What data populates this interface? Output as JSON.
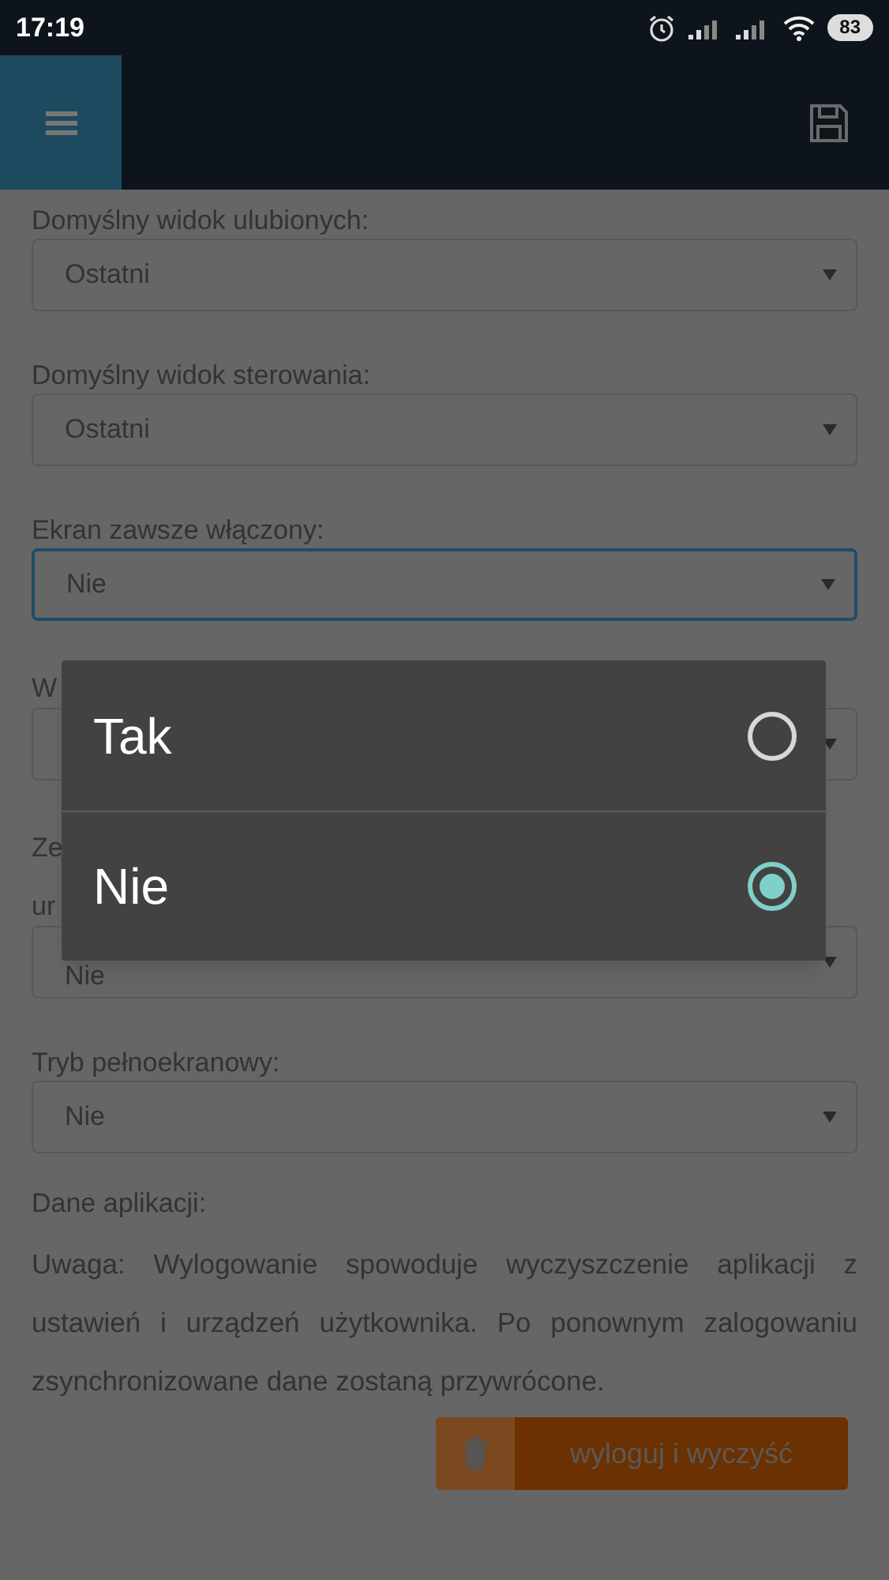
{
  "status_bar": {
    "time": "17:19",
    "battery": "83"
  },
  "form": [
    {
      "label": "Domyślny widok ulubionych:",
      "value": "Ostatni",
      "focused": false
    },
    {
      "label": "Domyślny widok sterowania:",
      "value": "Ostatni",
      "focused": false
    },
    {
      "label": "Ekran zawsze włączony:",
      "value": "Nie",
      "focused": true
    },
    {
      "label_lines": [
        "W"
      ],
      "focused": false
    },
    {
      "label_lines": [
        "Ze",
        "ur"
      ],
      "value": "Nie",
      "focused": false
    },
    {
      "label": "Tryb pełnoekranowy:",
      "value": "Nie",
      "focused": false
    }
  ],
  "app_data": {
    "label": "Dane aplikacji:",
    "note": "Uwaga: Wylogowanie spowoduje wyczyszczenie aplikacji z ustawień i urządzeń użytkownika. Po ponownym zalogowaniu zsynchronizowane dane zostaną przywrócone.",
    "button": "wyloguj i wyczyść"
  },
  "dialog": {
    "options": [
      {
        "label": "Tak",
        "selected": false
      },
      {
        "label": "Nie",
        "selected": true
      }
    ]
  }
}
